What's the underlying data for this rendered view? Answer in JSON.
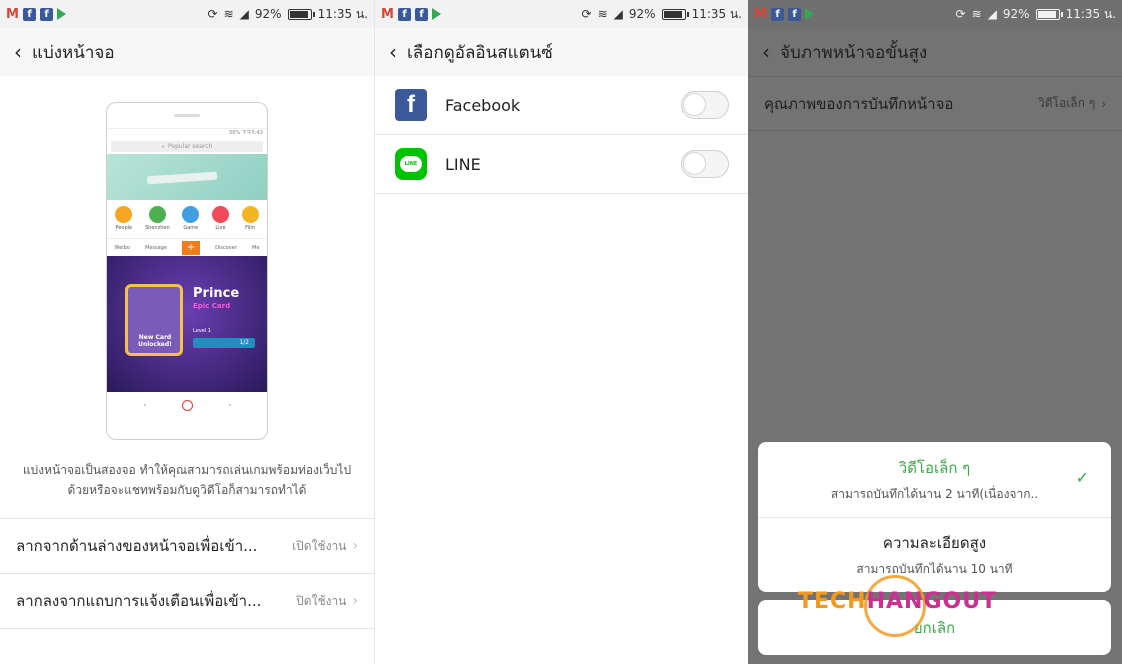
{
  "status_bar": {
    "battery": "92%",
    "time": "11:35 น."
  },
  "panel1": {
    "title": "แบ่งหน้าจอ",
    "mockup": {
      "status": "56% 下午5:43",
      "search_placeholder": "Popular search",
      "apps": [
        "People",
        "Shenzhen",
        "Game",
        "Live",
        "Film"
      ],
      "app_colors": [
        "#f5a623",
        "#4caf50",
        "#3f9fe0",
        "#ef4b5a",
        "#f5b423"
      ],
      "nav": [
        "Weibo",
        "Message",
        "",
        "Discover",
        "Me"
      ],
      "game_title": "Prince",
      "game_sub": "Epic Card",
      "game_card_text": "New Card Unlocked!",
      "game_level": "Level 1",
      "game_progress": "1/2"
    },
    "description": "แบ่งหน้าจอเป็นสองจอ ทำให้คุณสามารถเล่นเกมพร้อมท่องเว็บไป ด้วยหรือจะแชทพร้อมกับดูวิดีโอก็สามารถทำได้",
    "rows": [
      {
        "label": "ลากจากด้านล่างของหน้าจอเพื่อเข้า...",
        "value": "เปิดใช้งาน"
      },
      {
        "label": "ลากลงจากแถบการแจ้งเตือนเพื่อเข้า...",
        "value": "ปิดใช้งาน"
      }
    ]
  },
  "panel2": {
    "title": "เลือกดูอัลอินสแตนซ์",
    "apps": [
      {
        "name": "Facebook",
        "enabled": false
      },
      {
        "name": "LINE",
        "enabled": false
      }
    ]
  },
  "panel3": {
    "title": "จับภาพหน้าจอขั้นสูง",
    "row": {
      "label": "คุณภาพของการบันทึกหน้าจอ",
      "value": "วิดีโอเล็ก ๆ"
    },
    "options": [
      {
        "title": "วิดีโอเล็ก ๆ",
        "subtitle": "สามารถบันทึกได้นาน 2 นาที(เนื่องจาก..",
        "selected": true
      },
      {
        "title": "ความละเอียดสูง",
        "subtitle": "สามารถบันทึกได้นาน 10 นาที",
        "selected": false
      }
    ],
    "cancel": "ยกเลิก"
  },
  "watermark": {
    "part1": "TECH",
    "part2": "HANGOUT"
  },
  "colors": {
    "accent_green": "#3aa845",
    "facebook_blue": "#3b5998",
    "line_green": "#00c300",
    "dim_overlay": "#737373"
  }
}
